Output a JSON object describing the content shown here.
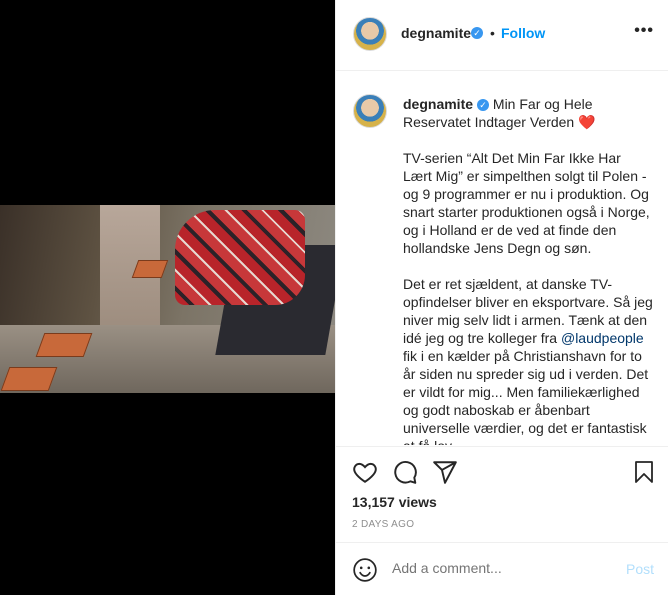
{
  "post": {
    "username": "degnamite",
    "verified_glyph": "✓",
    "dot": "•",
    "follow_label": "Follow",
    "more_label": "•••",
    "caption_title": "Min Far og Hele Reservatet Indtager Verden",
    "caption_heart": "❤️",
    "caption_p1": "TV-serien “Alt Det Min Far Ikke Har Lært Mig” er simpelthen solgt til Polen - og 9 programmer er nu i produktion. Og snart starter produktionen også i Norge, og i Holland er de ved at finde den hollandske Jens Degn og søn.",
    "caption_p2_before": "Det er ret sjældent, at danske TV-opfindelser bliver en eksportvare. Så jeg niver mig selv lidt i armen. Tænk at den idé jeg og tre kolleger fra",
    "caption_mention": "@laudpeople",
    "caption_p2_after": "fik i en kælder på Christianshavn for to år siden nu spreder sig ud i verden. Det er vildt for mig... Men familiekærlighed og godt naboskab er åbenbart universelle værdier, og det er fantastisk at få lov",
    "views": "13,157 views",
    "date": "2 DAYS AGO",
    "comment_placeholder": "Add a comment...",
    "post_label": "Post"
  },
  "icons": {
    "like": "heart-outline-icon",
    "comment": "comment-bubble-icon",
    "share": "paper-plane-icon",
    "save": "bookmark-icon",
    "emoji": "smiley-icon"
  },
  "colors": {
    "link": "#0095f6",
    "mention": "#00376b",
    "verified": "#3897f0",
    "muted": "#8e8e8e",
    "post_disabled": "#b2dffc"
  }
}
